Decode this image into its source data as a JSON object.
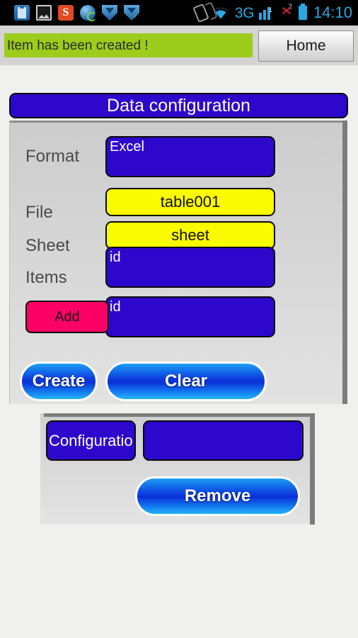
{
  "statusbar": {
    "time": "14:10",
    "network_label": "3G",
    "sim_signal_badge": "1",
    "sim_missing_badge": "2",
    "icons": [
      "clipboard-icon",
      "gallery-icon",
      "s-app-icon",
      "browser-globe-icon",
      "shield-icon",
      "shield-plus-icon",
      "auto-rotate-off-icon",
      "wifi-icon",
      "signal-bars-icon",
      "no-sim-icon",
      "battery-icon"
    ]
  },
  "toast": {
    "message": "Item has been created !",
    "background": "#9ccc1c"
  },
  "header": {
    "home_label": "Home"
  },
  "panel": {
    "title": "Data configuration",
    "rows": [
      {
        "label": "Format",
        "value": "Excel",
        "style": "blue"
      },
      {
        "label": "File",
        "value": "table001",
        "style": "yellow"
      },
      {
        "label": "Sheet",
        "value": "sheet",
        "style": "yellow"
      },
      {
        "label": "Items",
        "value": "id",
        "style": "blue"
      }
    ],
    "item_row": {
      "add_label": "Add",
      "value": "id"
    },
    "actions": {
      "create_label": "Create",
      "clear_label": "Clear"
    }
  },
  "list_panel": {
    "chip_label": "Configuratio",
    "chip_value": "",
    "remove_label": "Remove"
  },
  "colors": {
    "blue_field": "#2e07cc",
    "yellow_field": "#fbfb00",
    "pink_button": "#fc0066",
    "toast_green": "#9ccc1c",
    "accent_cyan": "#2aa7e0"
  }
}
